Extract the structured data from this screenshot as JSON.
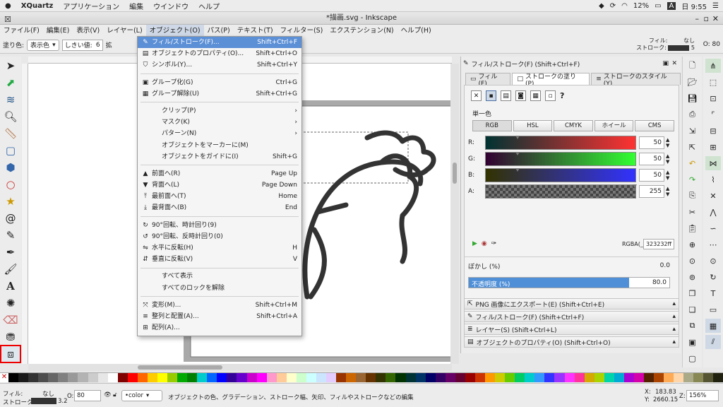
{
  "macbar": {
    "app": "XQuartz",
    "menus": [
      "アプリケーション",
      "編集",
      "ウインドウ",
      "ヘルプ"
    ],
    "battery": "12%",
    "input": "A",
    "clock": "日 9:55"
  },
  "window": {
    "title": "*描画.svg - Inkscape"
  },
  "menubar": [
    "ファイル(F)",
    "編集(E)",
    "表示(V)",
    "レイヤー(L)",
    "オブジェクト(O)",
    "パス(P)",
    "テキスト(T)",
    "フィルター(S)",
    "エクステンション(N)",
    "ヘルプ(H)"
  ],
  "ctrlbar": {
    "fill_label": "塗り色:",
    "fill_select": "表示色",
    "threshold_label": "しきい値:",
    "threshold_value": "6",
    "expand_label": "拡",
    "fill_indicator": "フィル:",
    "stroke_indicator": "ストローク:",
    "fill_value": "なし",
    "stroke_width": "5",
    "opacity_label": "O: 80"
  },
  "object_menu": [
    {
      "label": "フィル/ストローク(F)...",
      "shortcut": "Shift+Ctrl+F",
      "icon": "fill-stroke-icon",
      "glyph": "✎",
      "hi": true
    },
    {
      "label": "オブジェクトのプロパティ(O)...",
      "shortcut": "Shift+Ctrl+O",
      "icon": "properties-icon",
      "glyph": "▤"
    },
    {
      "label": "シンボル(Y)...",
      "shortcut": "Shift+Ctrl+Y",
      "icon": "symbols-icon",
      "glyph": "⛉"
    },
    {
      "sep": true
    },
    {
      "label": "グループ化(G)",
      "shortcut": "Ctrl+G",
      "icon": "group-icon",
      "glyph": "▣"
    },
    {
      "label": "グループ解除(U)",
      "shortcut": "Shift+Ctrl+G",
      "icon": "ungroup-icon",
      "glyph": "▦"
    },
    {
      "sep": true
    },
    {
      "label": "クリップ(P)",
      "shortcut": "›",
      "icon": "",
      "glyph": ""
    },
    {
      "label": "マスク(K)",
      "shortcut": "›",
      "icon": "",
      "glyph": ""
    },
    {
      "label": "パターン(N)",
      "shortcut": "›",
      "icon": "",
      "glyph": ""
    },
    {
      "label": "オブジェクトをマーカーに(M)",
      "shortcut": "",
      "icon": "",
      "glyph": ""
    },
    {
      "label": "オブジェクトをガイドに(I)",
      "shortcut": "Shift+G",
      "icon": "",
      "glyph": ""
    },
    {
      "sep": true
    },
    {
      "label": "前面へ(R)",
      "shortcut": "Page Up",
      "icon": "raise-icon",
      "glyph": "▲"
    },
    {
      "label": "背面へ(L)",
      "shortcut": "Page Down",
      "icon": "lower-icon",
      "glyph": "▼"
    },
    {
      "label": "最前面へ(T)",
      "shortcut": "Home",
      "icon": "raise-top-icon",
      "glyph": "⤒"
    },
    {
      "label": "最背面へ(B)",
      "shortcut": "End",
      "icon": "lower-bottom-icon",
      "glyph": "⤓"
    },
    {
      "sep": true
    },
    {
      "label": "90°回転、時計回り(9)",
      "shortcut": "",
      "icon": "rotate-cw-icon",
      "glyph": "↻"
    },
    {
      "label": "90°回転、反時計回り(0)",
      "shortcut": "",
      "icon": "rotate-ccw-icon",
      "glyph": "↺"
    },
    {
      "label": "水平に反転(H)",
      "shortcut": "H",
      "icon": "flip-h-icon",
      "glyph": "⇋"
    },
    {
      "label": "垂直に反転(V)",
      "shortcut": "V",
      "icon": "flip-v-icon",
      "glyph": "⇵"
    },
    {
      "sep": true
    },
    {
      "label": "すべて表示",
      "shortcut": "",
      "icon": "",
      "glyph": ""
    },
    {
      "label": "すべてのロックを解除",
      "shortcut": "",
      "icon": "",
      "glyph": ""
    },
    {
      "sep": true
    },
    {
      "label": "変形(M)...",
      "shortcut": "Shift+Ctrl+M",
      "icon": "transform-icon",
      "glyph": "⤧"
    },
    {
      "label": "整列と配置(A)...",
      "shortcut": "Shift+Ctrl+A",
      "icon": "align-icon",
      "glyph": "≡"
    },
    {
      "label": "配列(A)...",
      "shortcut": "",
      "icon": "arrange-icon",
      "glyph": "⊞"
    }
  ],
  "panel": {
    "title": "フィル/ストローク(F) (Shift+Ctrl+F)",
    "tabs": [
      "フィル(F)",
      "ストロークの塗り(P)",
      "ストロークのスタイル(Y)"
    ],
    "paint_mode": "単一色",
    "color_modes": [
      "RGB",
      "HSL",
      "CMYK",
      "ホイール",
      "CMS"
    ],
    "channels": [
      {
        "label": "R:",
        "value": "50",
        "grad": "linear-gradient(90deg,#003232,#ff3232)",
        "pos": 0.2
      },
      {
        "label": "G:",
        "value": "50",
        "grad": "linear-gradient(90deg,#320032,#32ff32)",
        "pos": 0.2
      },
      {
        "label": "B:",
        "value": "50",
        "grad": "linear-gradient(90deg,#323200,#3232ff)",
        "pos": 0.2
      },
      {
        "label": "A:",
        "value": "255",
        "grad": "repeating-conic-gradient(#777 0% 25%,#444 0% 50%) 0 0/8px 8px",
        "pos": 1.0
      }
    ],
    "rgba_label": "RGBA(_):",
    "rgba_value": "323232ff",
    "blur_label": "ぼかし (%)",
    "blur_value": "0.0",
    "opacity_label": "不透明度 (%)",
    "opacity_value": "80.0",
    "docks": [
      "PNG 画像にエクスポート(E) (Shift+Ctrl+E)",
      "フィル/ストローク(F) (Shift+Ctrl+F)",
      "レイヤー(S) (Shift+Ctrl+L)",
      "オブジェクトのプロパティ(O) (Shift+Ctrl+O)"
    ]
  },
  "status": {
    "fill_label": "フィル:",
    "fill_value": "なし",
    "stroke_label": "ストローク:",
    "stroke_value": "3.2",
    "opacity_label": "O:",
    "opacity_value": "80",
    "layer_select": "•color",
    "message": "オブジェクトの色、グラデーション、ストローク幅、矢印、フィルやストロークなどの編集",
    "x_label": "X:",
    "x_value": "183.83",
    "y_label": "Y:",
    "y_value": "2660.15",
    "zoom_label": "Z:",
    "zoom_value": "156%"
  },
  "palette_colors": [
    "#000",
    "#1a1a1a",
    "#333",
    "#4d4d4d",
    "#666",
    "#808080",
    "#999",
    "#b3b3b3",
    "#ccc",
    "#e6e6e6",
    "#fff",
    "#800000",
    "#ff0000",
    "#ff6600",
    "#ffcc00",
    "#ffff00",
    "#99cc00",
    "#00aa00",
    "#008000",
    "#00cccc",
    "#0066ff",
    "#0000ff",
    "#330099",
    "#6600cc",
    "#cc00cc",
    "#ff00ff",
    "#ff99cc",
    "#ffcc99",
    "#ffffcc",
    "#ccffcc",
    "#ccffff",
    "#cce5ff",
    "#e5ccff",
    "#993300",
    "#cc6600",
    "#996633",
    "#663300",
    "#333300",
    "#336600",
    "#003300",
    "#003333",
    "#003366",
    "#000066",
    "#330066",
    "#660066",
    "#660033",
    "#990000",
    "#cc3300",
    "#ff9900",
    "#cccc00",
    "#66cc00",
    "#00cc66",
    "#00cccc",
    "#3399ff",
    "#3333ff",
    "#9933ff",
    "#ff33ff",
    "#ff3399",
    "#d4aa00",
    "#aad400",
    "#00d4aa",
    "#00aad4",
    "#aa00d4",
    "#d400aa",
    "#552200",
    "#aa4400",
    "#ffaa55",
    "#ffd5aa",
    "#aaaa88",
    "#888855",
    "#555533",
    "#222211"
  ]
}
